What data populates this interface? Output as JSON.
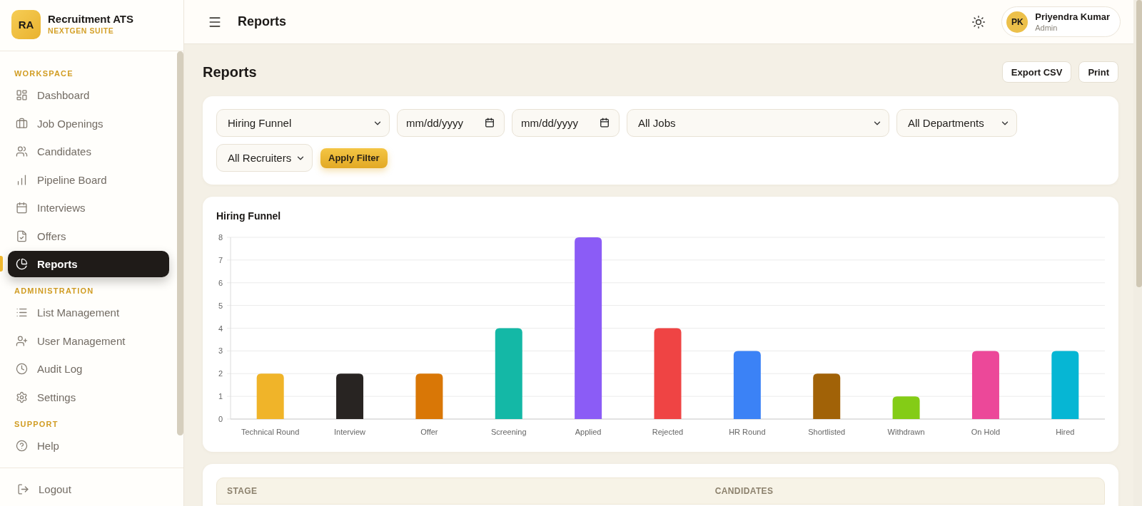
{
  "sidebar": {
    "brand": {
      "initials": "RA",
      "name": "Recruitment ATS",
      "tagline": "NEXTGEN SUITE"
    },
    "sections": [
      {
        "title": "WORKSPACE",
        "items": [
          {
            "label": "Dashboard",
            "selected": false
          },
          {
            "label": "Job Openings",
            "selected": false
          },
          {
            "label": "Candidates",
            "selected": false
          },
          {
            "label": "Pipeline Board",
            "selected": false
          },
          {
            "label": "Interviews",
            "selected": false
          },
          {
            "label": "Offers",
            "selected": false
          },
          {
            "label": "Reports",
            "selected": true
          }
        ]
      },
      {
        "title": "ADMINISTRATION",
        "items": [
          {
            "label": "List Management",
            "selected": false
          },
          {
            "label": "User Management",
            "selected": false
          },
          {
            "label": "Audit Log",
            "selected": false
          },
          {
            "label": "Settings",
            "selected": false
          }
        ]
      },
      {
        "title": "SUPPORT",
        "items": [
          {
            "label": "Help",
            "selected": false
          }
        ]
      }
    ],
    "footer": {
      "label": "Logout"
    }
  },
  "top_bar": {
    "title": "Reports",
    "user": {
      "initials": "PK",
      "name": "Priyendra Kumar",
      "role": "Admin"
    }
  },
  "page_header": {
    "title": "Reports",
    "actions": [
      "Export CSV",
      "Print"
    ]
  },
  "filters": {
    "controls": [
      {
        "kind": "select",
        "value": "Hiring Funnel"
      },
      {
        "kind": "date",
        "placeholder": "mm/dd/yyyy"
      },
      {
        "kind": "date",
        "placeholder": "mm/dd/yyyy"
      },
      {
        "kind": "select",
        "value": "All Jobs"
      },
      {
        "kind": "select",
        "value": "All Departments"
      },
      {
        "kind": "select",
        "value": "All Recruiters"
      }
    ],
    "apply_button": "Apply Filter"
  },
  "chart_card": {
    "chart_data": {
      "type": "bar",
      "title": "Hiring Funnel",
      "categories": [
        "Technical Round",
        "Interview",
        "Offer",
        "Screening",
        "Applied",
        "Rejected",
        "HR Round",
        "Shortlisted",
        "Withdrawn",
        "On Hold",
        "Hired"
      ],
      "values": [
        2,
        2,
        2,
        4,
        8,
        4,
        3,
        2,
        1,
        3,
        3
      ],
      "colors": [
        "#f0b429",
        "#282422",
        "#d97706",
        "#14b8a6",
        "#8b5cf6",
        "#ef4444",
        "#3b82f6",
        "#a16207",
        "#84cc16",
        "#ec4899",
        "#06b6d4"
      ],
      "ylim": [
        0,
        8
      ],
      "yticks": [
        0,
        1,
        2,
        3,
        4,
        5,
        6,
        7,
        8
      ],
      "grid": true
    }
  },
  "table": {
    "columns": [
      "STAGE",
      "CANDIDATES"
    ]
  }
}
